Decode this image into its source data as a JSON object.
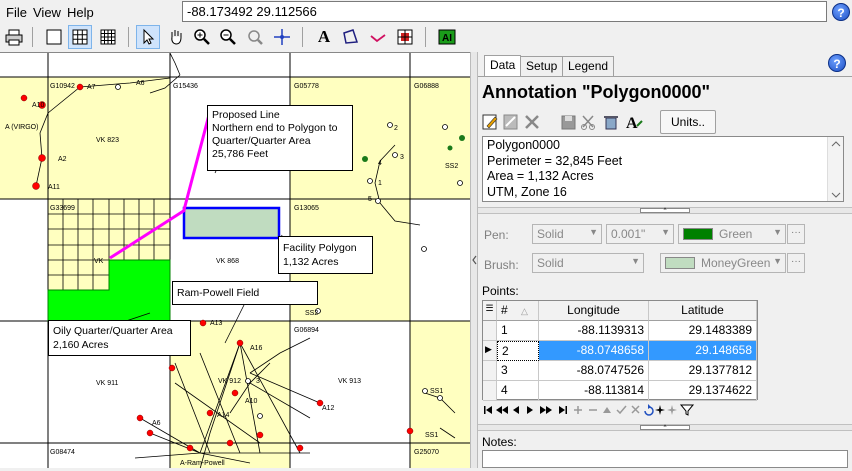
{
  "menu": {
    "items": [
      "File",
      "View",
      "Help"
    ]
  },
  "coordinates": {
    "value": "-88.173492  29.112566"
  },
  "help_icon": "?",
  "map": {
    "blocks": [
      "G10942",
      "G15436",
      "G05778",
      "G06888",
      "G33699",
      "G13065",
      "G08474",
      "G25070",
      "G06894"
    ],
    "areas": [
      "VK 823",
      "VK 868",
      "VK 911",
      "VK 912",
      "VK 913",
      "VK"
    ],
    "wells": [
      "A10",
      "A7",
      "A6",
      "A2",
      "A11",
      "A13",
      "A16",
      "A10",
      "A12",
      "A14",
      "A6",
      "SS2",
      "SS2",
      "SS1",
      "SS1",
      "4",
      "3",
      "2",
      "1",
      "5",
      "3"
    ],
    "labels": [
      "A (VIRGO)",
      "A-Ram-Powell"
    ],
    "callouts": {
      "proposed_line": [
        "Proposed Line",
        "Northern end to Polygon to",
        "Quarter/Quarter Area",
        "25,786 Feet"
      ],
      "facility": [
        "Facility Polygon",
        "1,132 Acres"
      ],
      "ram_powell": [
        "Ram-Powell Field"
      ],
      "oily": [
        "Oily Quarter/Quarter Area",
        "2,160 Acres"
      ]
    }
  },
  "panel": {
    "tabs": [
      "Data",
      "Setup",
      "Legend"
    ],
    "title": "Annotation \"Polygon0000\"",
    "units_label": "Units..",
    "info": [
      "Polygon0000",
      "Perimeter = 32,845 Feet",
      "Area = 1,132 Acres",
      "UTM, Zone 16"
    ],
    "pen": {
      "label": "Pen:",
      "style": "Solid",
      "width": "0.001\"",
      "color_name": "Green",
      "color": "#008000"
    },
    "brush": {
      "label": "Brush:",
      "style": "Solid",
      "color_name": "MoneyGreen",
      "color": "#c0dcc0"
    },
    "points_label": "Points:",
    "columns": [
      "#",
      "Longitude",
      "Latitude"
    ],
    "points": [
      {
        "n": "1",
        "lon": "-88.1139313",
        "lat": "29.1483389"
      },
      {
        "n": "2",
        "lon": "-88.0748658",
        "lat": "29.148658"
      },
      {
        "n": "3",
        "lon": "-88.0747526",
        "lat": "29.1377812"
      },
      {
        "n": "4",
        "lon": "-88.113814",
        "lat": "29.1374622"
      }
    ],
    "notes_label": "Notes:"
  },
  "colors": {
    "map_yellow": "#ffffc0",
    "oily_green": "#00ff00",
    "facility_fill": "#c0dcc0",
    "line_magenta": "#ff00ff",
    "facility_border": "#0000ff",
    "selection": "#3399ff"
  }
}
